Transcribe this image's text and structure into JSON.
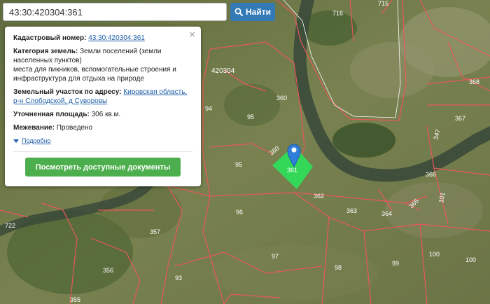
{
  "search": {
    "value": "43:30:420304:361",
    "button_label": "Найти"
  },
  "popup": {
    "close_glyph": "×",
    "cadastral_label": "Кадастровый номер:",
    "cadastral_value": "43:30:420304:361",
    "category_label": "Категория земель:",
    "category_value_1": "Земли поселений (земли населенных пунктов)",
    "category_value_2": "места для пикников, вспомогательные строения и инфраструктура для отдыха на природе",
    "address_label": "Земельный участок по адресу:",
    "address_value": "Кировская область, р-н Слободской, д Суворовы",
    "area_label": "Уточненная площадь:",
    "area_value": "306 кв.м.",
    "survey_label": "Межевание:",
    "survey_value": "Проведено",
    "details_link": "Подробно",
    "docs_button": "Посмотреть доступные документы"
  },
  "map": {
    "labels": {
      "l716": "716",
      "l715": "715",
      "lq": "420304",
      "l360a": "360",
      "l94": "94",
      "l95a": "95",
      "l360b": "360",
      "l95b": "95",
      "l368": "368",
      "l367": "367",
      "l347": "347",
      "l366": "366",
      "l101": "101",
      "l362": "362",
      "l363": "363",
      "l364": "364",
      "l365": "365",
      "l96": "96",
      "l357": "357",
      "l722": "722",
      "l97": "97",
      "l98": "98",
      "l99": "99",
      "l100a": "100",
      "l100b": "100",
      "l356": "356",
      "l93": "93",
      "l355": "355",
      "lpin": "361"
    },
    "colors": {
      "boundary": "#e8585a",
      "highlight": "#2ee05a",
      "marker": "#2f7fd8"
    },
    "icons": {
      "marker": "map-marker-icon",
      "search": "search-icon",
      "close": "close-icon"
    }
  }
}
